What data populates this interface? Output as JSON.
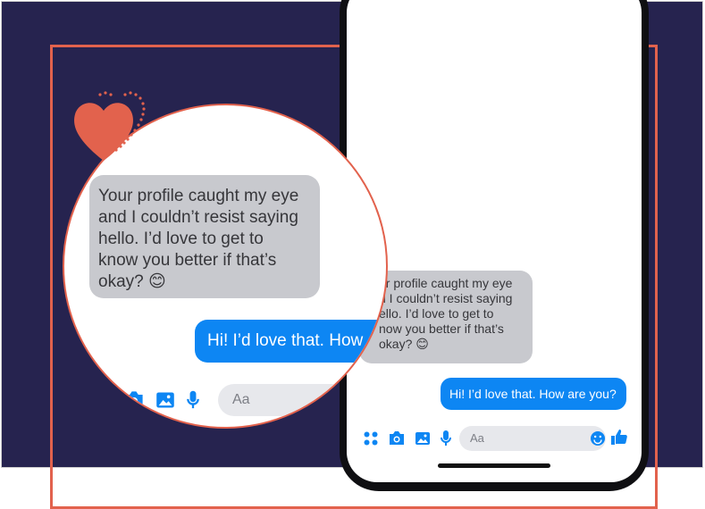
{
  "colors": {
    "background": "#26234f",
    "accent": "#e2624d",
    "sent_bubble": "#0d86f3",
    "received_bubble": "#c8c9ce",
    "icon_blue": "#0d86f3"
  },
  "zoom": {
    "received_message": "Your profile caught my eye\nand I couldn’t resist saying\nhello. I’d love to get to\nknow you better if that’s\nokay? 😊",
    "sent_message": "Hi! I’d love that. How",
    "composer_placeholder": "Aa",
    "composer_icons": [
      "camera-icon",
      "image-icon",
      "microphone-icon"
    ]
  },
  "phone": {
    "received_message": "ur profile caught my eye\nd I couldn’t resist saying\nello. I’d love to get to\nnow you better if that’s\nokay? 😊",
    "sent_message": "Hi! I’d love that. How are you?",
    "composer_placeholder": "Aa",
    "composer_icons": [
      "apps-icon",
      "camera-icon",
      "image-icon",
      "microphone-icon",
      "emoji-icon",
      "thumbs-up-icon"
    ]
  }
}
